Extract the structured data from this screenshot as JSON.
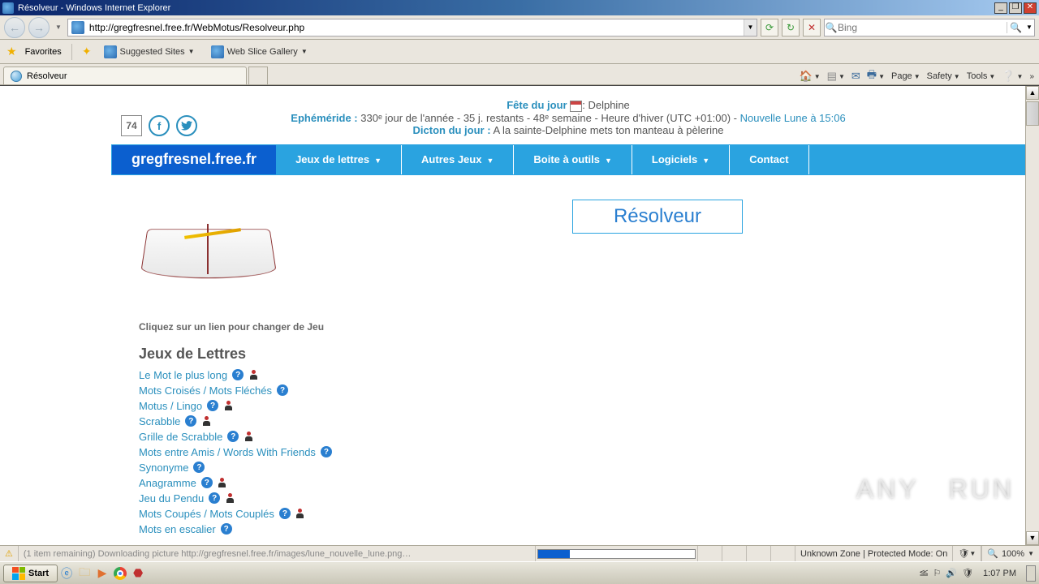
{
  "window": {
    "title": "Résolveur - Windows Internet Explorer"
  },
  "addr": {
    "url": "http://gregfresnel.free.fr/WebMotus/Resolveur.php"
  },
  "search": {
    "placeholder": "Bing"
  },
  "favbar": {
    "favorites": "Favorites",
    "suggested": "Suggested Sites",
    "webslice": "Web Slice Gallery"
  },
  "tab": {
    "title": "Résolveur"
  },
  "cmdbar": {
    "page": "Page",
    "safety": "Safety",
    "tools": "Tools"
  },
  "info": {
    "fete_label": "Fête du jour",
    "fete_sep": ":",
    "fete_name": "Delphine",
    "ephem_label": "Ephéméride :",
    "ephem_text": " 330ᵉ jour de l'année - 35 j. restants - 48ᵉ semaine - Heure d'hiver (UTC +01:00) - ",
    "moon": "Nouvelle Lune à 15:06",
    "dicton_label": "Dicton du jour :",
    "dicton_text": " A la sainte-Delphine mets ton manteau à pèlerine"
  },
  "social": {
    "count": "74"
  },
  "menu": {
    "logo": "gregfresnel.free.fr",
    "items": [
      "Jeux de lettres",
      "Autres Jeux",
      "Boite à outils",
      "Logiciels",
      "Contact"
    ]
  },
  "main": {
    "resolver": "Résolveur",
    "instr": "Cliquez sur un lien pour changer de Jeu",
    "jdl": "Jeux de Lettres",
    "links": [
      {
        "t": "Le Mot le plus long",
        "h": true,
        "u": true
      },
      {
        "t": "Mots Croisés / Mots Fléchés",
        "h": true,
        "u": false
      },
      {
        "t": "Motus / Lingo",
        "h": true,
        "u": true
      },
      {
        "t": "Scrabble",
        "h": true,
        "u": true
      },
      {
        "t": "Grille de Scrabble",
        "h": true,
        "u": true
      },
      {
        "t": "Mots entre Amis / Words With Friends",
        "h": true,
        "u": false
      },
      {
        "t": "Synonyme",
        "h": true,
        "u": false
      },
      {
        "t": "Anagramme",
        "h": true,
        "u": true
      },
      {
        "t": "Jeu du Pendu",
        "h": true,
        "u": true
      },
      {
        "t": "Mots Coupés / Mots Couplés",
        "h": true,
        "u": true
      },
      {
        "t": "Mots en escalier",
        "h": true,
        "u": false
      }
    ]
  },
  "status": {
    "msg": "(1 item remaining) Downloading picture http://gregfresnel.free.fr/images/lune_nouvelle_lune.png…",
    "zone": "Unknown Zone | Protected Mode: On",
    "zoom": "100%"
  },
  "taskbar": {
    "start": "Start",
    "time": "1:07 PM"
  },
  "watermark": {
    "a": "ANY",
    "b": "RUN"
  }
}
